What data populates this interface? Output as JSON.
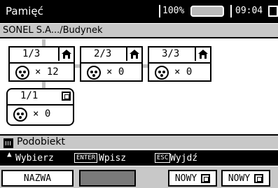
{
  "status": {
    "title": "Pamięć",
    "battery_percent": "100%",
    "clock": "09:04"
  },
  "path": "SONEL S.A.../Budynek",
  "nodes": [
    {
      "index": "1/3",
      "count": "× 12",
      "icon": "building-icon"
    },
    {
      "index": "2/3",
      "count": "× 0",
      "icon": "building-icon"
    },
    {
      "index": "3/3",
      "count": "× 0",
      "icon": "building-icon"
    },
    {
      "index": "1/1",
      "count": "× 0",
      "icon": "frame-icon"
    }
  ],
  "subobject_label": "Podobiekt",
  "help": {
    "select": "Wybierz",
    "enter_key": "ENTER",
    "enter": "Wpisz",
    "esc_key": "ESC",
    "esc": "Wyjdź"
  },
  "softkeys": {
    "name": "NAZWA",
    "new1": "NOWY",
    "new2": "NOWY"
  }
}
